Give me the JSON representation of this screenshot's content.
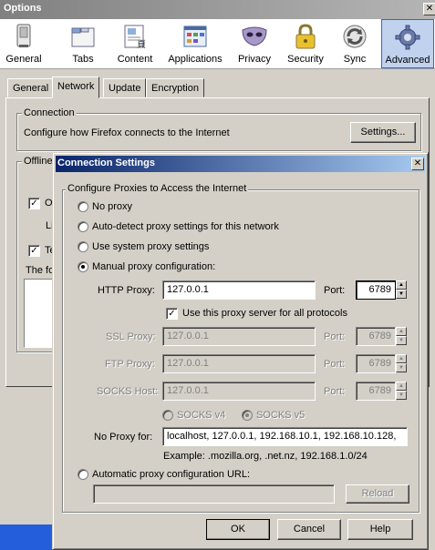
{
  "options_window": {
    "title": "Options",
    "close_glyph": "✕"
  },
  "toolbar": {
    "items": [
      {
        "label": "General",
        "icon": "switch-icon"
      },
      {
        "label": "Tabs",
        "icon": "tabs-icon"
      },
      {
        "label": "Content",
        "icon": "content-icon"
      },
      {
        "label": "Applications",
        "icon": "applications-icon"
      },
      {
        "label": "Privacy",
        "icon": "mask-icon"
      },
      {
        "label": "Security",
        "icon": "lock-icon"
      },
      {
        "label": "Sync",
        "icon": "sync-icon"
      },
      {
        "label": "Advanced",
        "icon": "gear-icon"
      }
    ],
    "selected": "Advanced"
  },
  "advanced_tabs": {
    "items": [
      "General",
      "Network",
      "Update",
      "Encryption"
    ],
    "selected": "Network"
  },
  "network": {
    "connection_legend": "Connection",
    "connection_desc": "Configure how Firefox connects to the Internet",
    "settings_button": "Settings...",
    "offline_legend_partial": "Offline",
    "offline_check1_partial": "O",
    "offline_li_partial": "Li",
    "offline_check2_partial": "Te",
    "offline_text_partial": "The fo"
  },
  "connection_settings": {
    "title": "Connection Settings",
    "close_glyph": "✕",
    "group_legend": "Configure Proxies to Access the Internet",
    "options": {
      "no_proxy": "No proxy",
      "auto_detect": "Auto-detect proxy settings for this network",
      "system": "Use system proxy settings",
      "manual": "Manual proxy configuration:",
      "auto_url": "Automatic proxy configuration URL:"
    },
    "selected_option": "manual",
    "http": {
      "label": "HTTP Proxy:",
      "value": "127.0.0.1",
      "port_label": "Port:",
      "port": "6789"
    },
    "use_for_all": {
      "label": "Use this proxy server for all protocols",
      "checked": true
    },
    "ssl": {
      "label": "SSL Proxy:",
      "value": "127.0.0.1",
      "port_label": "Port:",
      "port": "6789"
    },
    "ftp": {
      "label": "FTP Proxy:",
      "value": "127.0.0.1",
      "port_label": "Port:",
      "port": "6789"
    },
    "socks": {
      "label": "SOCKS Host:",
      "value": "127.0.0.1",
      "port_label": "Port:",
      "port": "6789"
    },
    "socks_v4": "SOCKS v4",
    "socks_v5": "SOCKS v5",
    "no_proxy_for": {
      "label": "No Proxy for:",
      "value": "localhost, 127.0.0.1, 192.168.10.1, 192.168.10.128,"
    },
    "example": "Example: .mozilla.org, .net.nz, 192.168.1.0/24",
    "auto_url_value": "",
    "reload_button": "Reload",
    "ok_button": "OK",
    "cancel_button": "Cancel",
    "help_button": "Help"
  },
  "colors": {
    "dialog_face": "#d4d0c8",
    "active_title": "#0a246a",
    "inactive_title": "#808080",
    "selected_toolbar": "#c1d2ee"
  }
}
